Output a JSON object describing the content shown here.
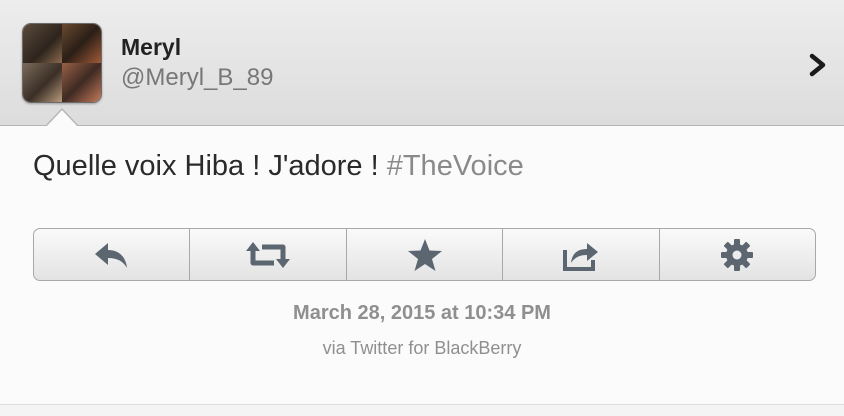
{
  "profile": {
    "name": "Meryl",
    "handle": "@Meryl_B_89"
  },
  "tweet": {
    "text": "Quelle voix Hiba ! J'adore ! ",
    "hashtag": "#TheVoice"
  },
  "actions": [
    {
      "icon": "reply-icon"
    },
    {
      "icon": "retweet-icon"
    },
    {
      "icon": "star-icon"
    },
    {
      "icon": "share-icon"
    },
    {
      "icon": "gear-icon"
    }
  ],
  "meta": {
    "date": "March 28, 2015 at 10:34 PM",
    "via": "via Twitter for BlackBerry"
  },
  "colors": {
    "icon": "#5c6670",
    "hashtag": "#8a8a8a",
    "meta": "#8f8f8f"
  }
}
